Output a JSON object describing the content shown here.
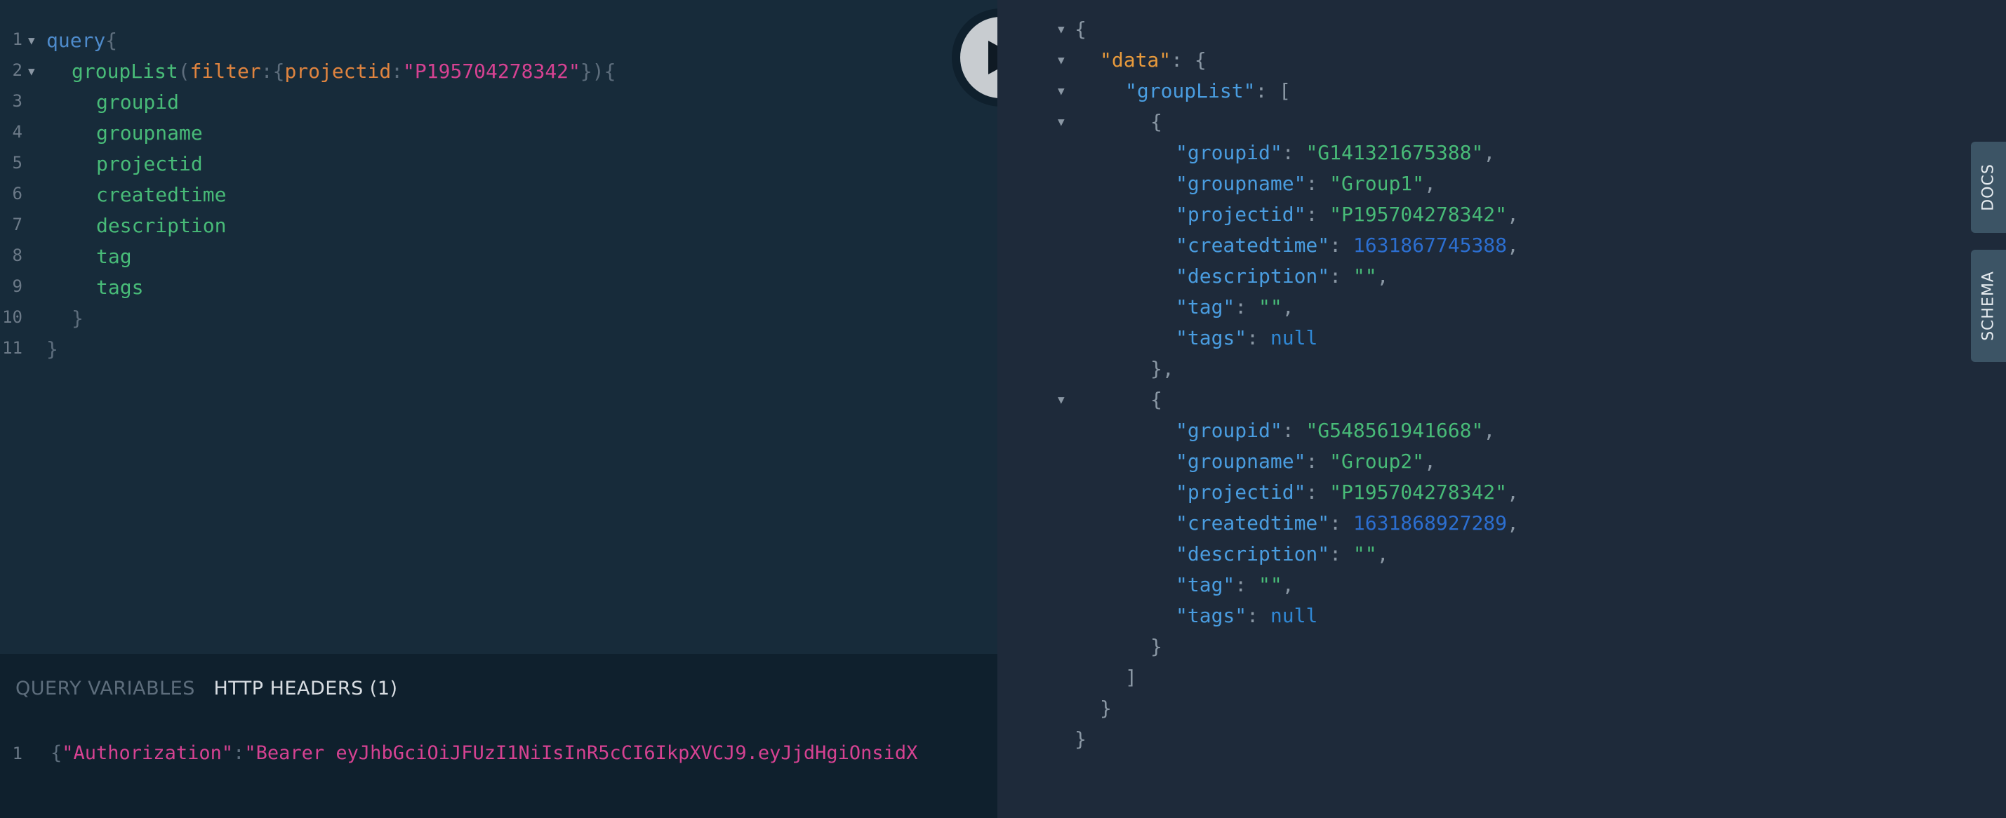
{
  "query_editor": {
    "line_numbers": [
      "1",
      "2",
      "3",
      "4",
      "5",
      "6",
      "7",
      "8",
      "9",
      "10",
      "11"
    ],
    "query_keyword": "query",
    "open_brace": "{",
    "close_brace": "}",
    "field_grouplist": "groupList",
    "paren_open": "(",
    "paren_close": ")",
    "arg_filter": "filter",
    "colon": ":",
    "arg_projectid": "projectid",
    "arg_value": "\"P195704278342\"",
    "fields": [
      "groupid",
      "groupname",
      "projectid",
      "createdtime",
      "description",
      "tag",
      "tags"
    ]
  },
  "run_button": {
    "icon": "play-icon"
  },
  "bottom_panel": {
    "tab_variables": "QUERY VARIABLES",
    "tab_headers": "HTTP HEADERS (1)",
    "line_number": "1",
    "headers_open": "{",
    "headers_key": "\"Authorization\"",
    "headers_colon": ":",
    "headers_value": "\"Bearer eyJhbGciOiJFUzI1NiIsInR5cCI6IkpXVCJ9.eyJjdHgiOnsidX"
  },
  "result": {
    "open": "{",
    "data_key": "\"data\"",
    "grouplist_key": "\"groupList\"",
    "groups": [
      {
        "groupid": "\"G141321675388\"",
        "groupname": "\"Group1\"",
        "projectid": "\"P195704278342\"",
        "createdtime": "1631867745388",
        "description": "\"\"",
        "tag": "\"\"",
        "tags": "null"
      },
      {
        "groupid": "\"G548561941668\"",
        "groupname": "\"Group2\"",
        "projectid": "\"P195704278342\"",
        "createdtime": "1631868927289",
        "description": "\"\"",
        "tag": "\"\"",
        "tags": "null"
      }
    ],
    "keys": {
      "groupid": "\"groupid\"",
      "groupname": "\"groupname\"",
      "projectid": "\"projectid\"",
      "createdtime": "\"createdtime\"",
      "description": "\"description\"",
      "tag": "\"tag\"",
      "tags": "\"tags\""
    }
  },
  "side_tabs": {
    "docs": "DOCS",
    "schema": "SCHEMA"
  },
  "colors": {
    "editor_bg": "#172b3a",
    "result_bg": "#1e2a3a",
    "keyword": "#4e8bcb",
    "field": "#48bb78",
    "string": "#d64292",
    "argument": "#e0843f",
    "number": "#2c6fd1"
  }
}
